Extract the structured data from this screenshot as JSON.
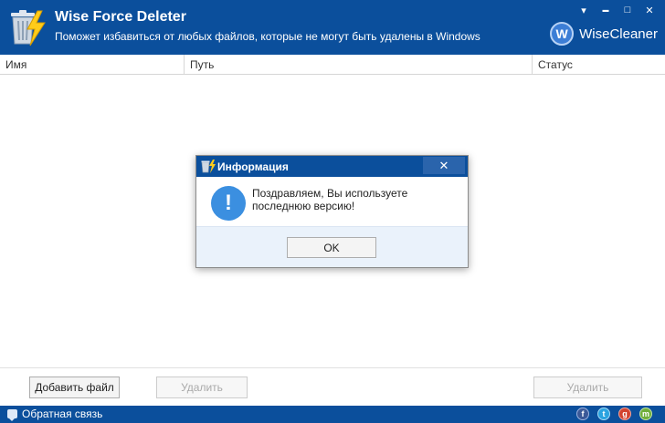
{
  "app": {
    "title": "Wise Force Deleter",
    "subtitle": "Поможет избавиться от любых файлов, которые не могут быть удалены в Windows",
    "brand": "WiseCleaner",
    "brand_letter": "W",
    "window_controls": {
      "menu_symbol": "▾",
      "minimize_symbol": "▬",
      "maximize_symbol": "□",
      "close_symbol": "✕"
    }
  },
  "table": {
    "columns": [
      "Имя",
      "Путь",
      "Статус"
    ]
  },
  "buttons": {
    "add_file": "Добавить файл",
    "delete": "Удалить",
    "delete_secondary": "Удалить"
  },
  "statusbar": {
    "feedback": "Обратная связь",
    "social": [
      "f",
      "t",
      "g",
      "m"
    ]
  },
  "dialog": {
    "title": "Информация",
    "message": "Поздравляем, Вы используете последнюю версию!",
    "ok_label": "OK",
    "close_symbol": "✕",
    "icon_symbol": "!"
  },
  "colors": {
    "header_bg": "#0b4f9c",
    "dialog_footer_bg": "#eaf2fb",
    "info_icon": "#3b8fe0"
  }
}
